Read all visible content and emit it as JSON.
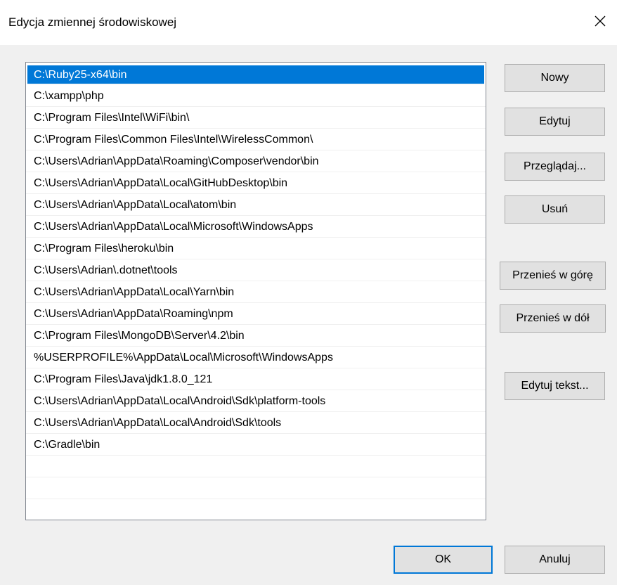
{
  "window": {
    "title": "Edycja zmiennej środowiskowej"
  },
  "paths": [
    "C:\\Ruby25-x64\\bin",
    "C:\\xampp\\php",
    "C:\\Program Files\\Intel\\WiFi\\bin\\",
    "C:\\Program Files\\Common Files\\Intel\\WirelessCommon\\",
    "C:\\Users\\Adrian\\AppData\\Roaming\\Composer\\vendor\\bin",
    "C:\\Users\\Adrian\\AppData\\Local\\GitHubDesktop\\bin",
    "C:\\Users\\Adrian\\AppData\\Local\\atom\\bin",
    "C:\\Users\\Adrian\\AppData\\Local\\Microsoft\\WindowsApps",
    "C:\\Program Files\\heroku\\bin",
    "C:\\Users\\Adrian\\.dotnet\\tools",
    "C:\\Users\\Adrian\\AppData\\Local\\Yarn\\bin",
    "C:\\Users\\Adrian\\AppData\\Roaming\\npm",
    "C:\\Program Files\\MongoDB\\Server\\4.2\\bin",
    "%USERPROFILE%\\AppData\\Local\\Microsoft\\WindowsApps",
    "C:\\Program Files\\Java\\jdk1.8.0_121",
    "C:\\Users\\Adrian\\AppData\\Local\\Android\\Sdk\\platform-tools",
    "C:\\Users\\Adrian\\AppData\\Local\\Android\\Sdk\\tools",
    "C:\\Gradle\\bin",
    "",
    "",
    ""
  ],
  "selected_index": 0,
  "buttons": {
    "new": "Nowy",
    "edit": "Edytuj",
    "browse": "Przeglądaj...",
    "delete": "Usuń",
    "move_up": "Przenieś w górę",
    "move_down": "Przenieś w dół",
    "edit_text": "Edytuj tekst...",
    "ok": "OK",
    "cancel": "Anuluj"
  },
  "icons": {
    "close": "close-icon"
  },
  "colors": {
    "selection": "#0078d7",
    "dialog_bg": "#f0f0f0",
    "button_bg": "#e1e1e1"
  }
}
